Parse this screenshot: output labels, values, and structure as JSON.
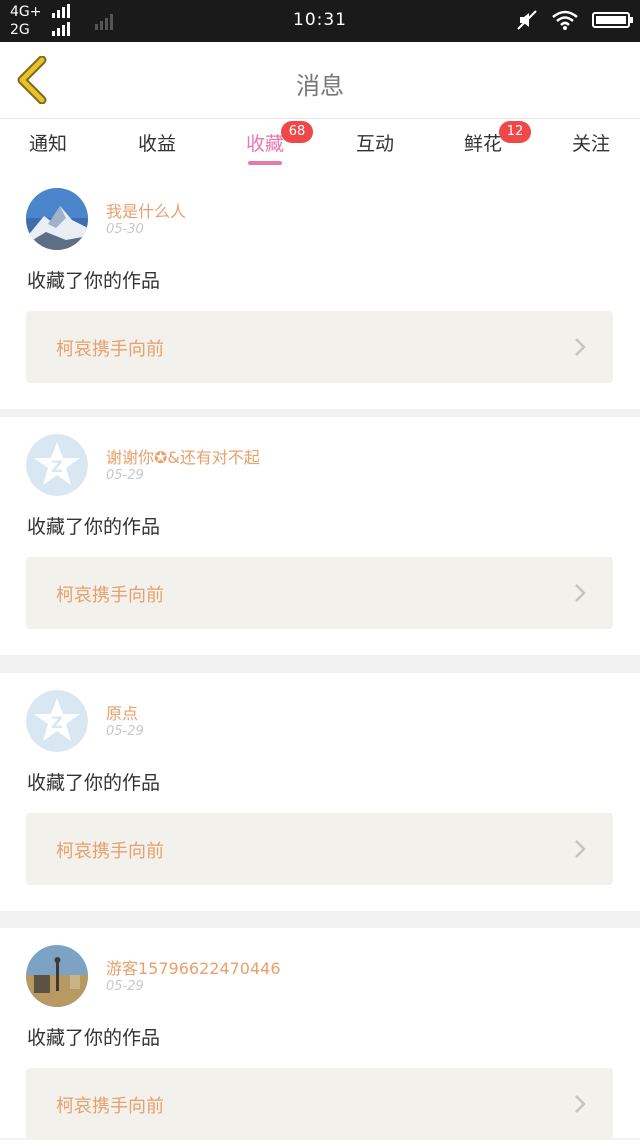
{
  "status_bar": {
    "net1": "4G+",
    "net2": "2G",
    "time": "10:31"
  },
  "header": {
    "title": "消息"
  },
  "tabs": [
    {
      "label": "通知",
      "badge": ""
    },
    {
      "label": "收益",
      "badge": ""
    },
    {
      "label": "收藏",
      "badge": "68"
    },
    {
      "label": "互动",
      "badge": ""
    },
    {
      "label": "鲜花",
      "badge": "12"
    },
    {
      "label": "关注",
      "badge": ""
    }
  ],
  "active_tab": "收藏",
  "colors": {
    "accent": "#e879ae",
    "badge": "#f04848",
    "username": "#e8a06c",
    "back_arrow": "#e8c229"
  },
  "items": [
    {
      "username": "我是什么人",
      "date": "05-30",
      "action": "收藏了你的作品",
      "work_title": "柯哀携手向前",
      "avatar": "mountain-photo"
    },
    {
      "username": "谢谢你✪&还有对不起",
      "date": "05-29",
      "action": "收藏了你的作品",
      "work_title": "柯哀携手向前",
      "avatar": "default-star-avatar"
    },
    {
      "username": "原点",
      "date": "05-29",
      "action": "收藏了你的作品",
      "work_title": "柯哀携手向前",
      "avatar": "default-star-avatar"
    },
    {
      "username": "游客15796622470446",
      "date": "05-29",
      "action": "收藏了你的作品",
      "work_title": "柯哀携手向前",
      "avatar": "field-photo"
    }
  ]
}
